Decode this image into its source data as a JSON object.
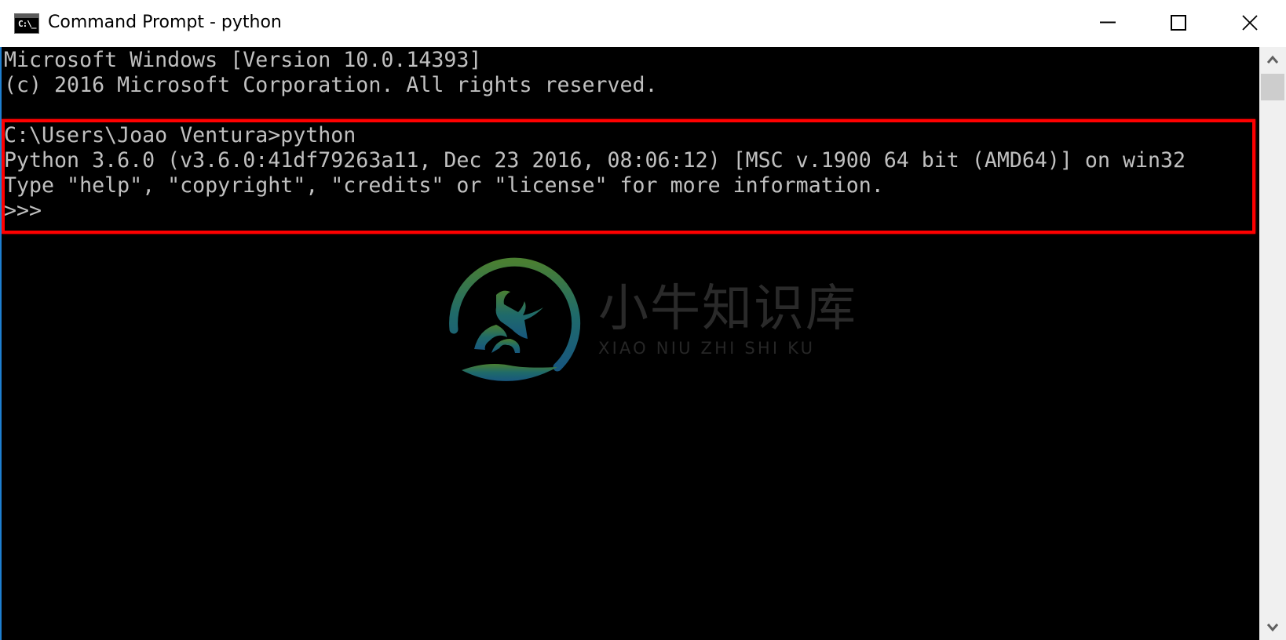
{
  "window": {
    "title": "Command Prompt - python",
    "icon": "console-icon",
    "icon_glyph": "C:\\_",
    "controls": {
      "minimize": "minimize-icon",
      "maximize": "maximize-icon",
      "close": "close-icon"
    }
  },
  "console": {
    "lines": [
      "Microsoft Windows [Version 10.0.14393]",
      "(c) 2016 Microsoft Corporation. All rights reserved.",
      "",
      "C:\\Users\\Joao Ventura>python",
      "Python 3.6.0 (v3.6.0:41df79263a11, Dec 23 2016, 08:06:12) [MSC v.1900 64 bit (AMD64)] on win32",
      "Type \"help\", \"copyright\", \"credits\" or \"license\" for more information.",
      ">>>"
    ],
    "text_color": "#c0c0c0",
    "background": "#000000",
    "highlight_color": "#ff0000"
  },
  "scrollbar": {
    "up": "scroll-up-arrow-icon",
    "down": "scroll-down-arrow-icon"
  },
  "watermark": {
    "chinese": "小牛知识库",
    "pinyin": "XIAO NIU ZHI SHI KU",
    "logo": "bull-logo-icon"
  },
  "colors": {
    "accent_border": "#1e7fd0",
    "logo_top": "#3f7a3a",
    "logo_bottom": "#1a5e7a"
  }
}
